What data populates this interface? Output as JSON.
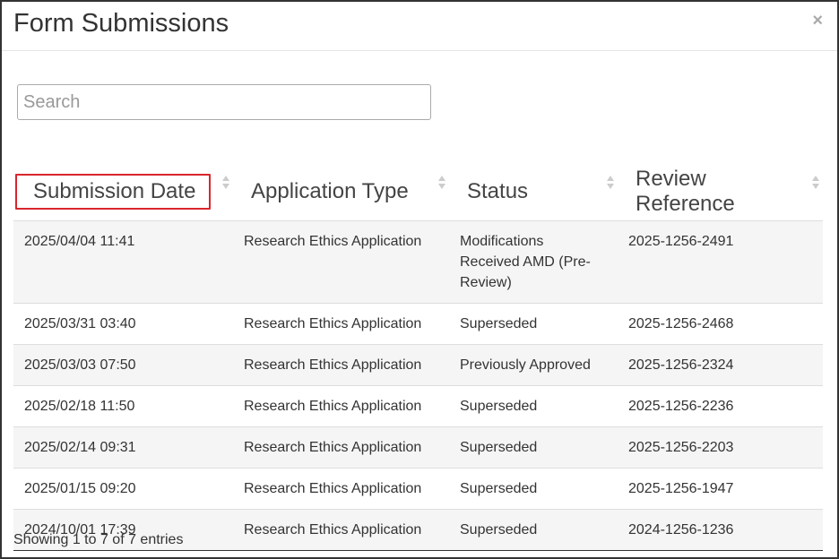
{
  "modal": {
    "title": "Form Submissions",
    "close": "×",
    "search": {
      "placeholder": "Search",
      "value": ""
    },
    "columns": [
      "Submission Date",
      "Application Type",
      "Status",
      "Review Reference"
    ],
    "rows": [
      [
        "2025/04/04 11:41",
        "Research Ethics Application",
        "Modifications Received AMD (Pre-Review)",
        "2025-1256-2491"
      ],
      [
        "2025/03/31 03:40",
        "Research Ethics Application",
        "Superseded",
        "2025-1256-2468"
      ],
      [
        "2025/03/03 07:50",
        "Research Ethics Application",
        "Previously Approved",
        "2025-1256-2324"
      ],
      [
        "2025/02/18 11:50",
        "Research Ethics Application",
        "Superseded",
        "2025-1256-2236"
      ],
      [
        "2025/02/14 09:31",
        "Research Ethics Application",
        "Superseded",
        "2025-1256-2203"
      ],
      [
        "2025/01/15 09:20",
        "Research Ethics Application",
        "Superseded",
        "2025-1256-1947"
      ],
      [
        "2024/10/01 17:39",
        "Research Ethics Application",
        "Superseded",
        "2024-1256-1236"
      ]
    ],
    "footer": "Showing 1 to 7 of 7 entries",
    "highlight_color": "#d9262c"
  }
}
